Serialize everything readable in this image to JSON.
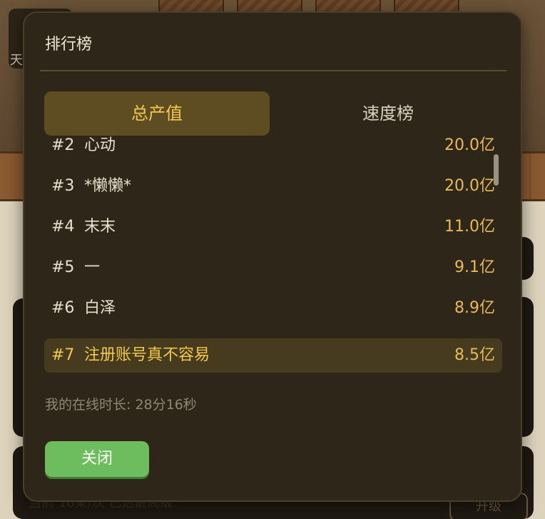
{
  "background": {
    "corner_text": "天",
    "bottom_text": "当前 16桌/次 已达最高级",
    "upgrade_label": "升级"
  },
  "modal": {
    "title": "排行榜",
    "tabs": [
      {
        "label": "总产值",
        "active": true
      },
      {
        "label": "速度榜",
        "active": false
      }
    ],
    "rows": [
      {
        "rank": "#2",
        "name": "心动",
        "value": "20.0亿",
        "highlight": false
      },
      {
        "rank": "#3",
        "name": "*懒懒*",
        "value": "20.0亿",
        "highlight": false
      },
      {
        "rank": "#4",
        "name": "末末",
        "value": "11.0亿",
        "highlight": false
      },
      {
        "rank": "#5",
        "name": "一",
        "value": "9.1亿",
        "highlight": false
      },
      {
        "rank": "#6",
        "name": "白泽",
        "value": "8.9亿",
        "highlight": false
      },
      {
        "rank": "#7",
        "name": "注册账号真不容易",
        "value": "8.5亿",
        "highlight": true
      }
    ],
    "online_time": "我的在线时长: 28分16秒",
    "close_label": "关闭"
  },
  "colors": {
    "modal_bg": "#2e2719",
    "accent_gold": "#f2c94c",
    "value_gold": "#e8b957",
    "close_green": "#6dbd5e"
  }
}
